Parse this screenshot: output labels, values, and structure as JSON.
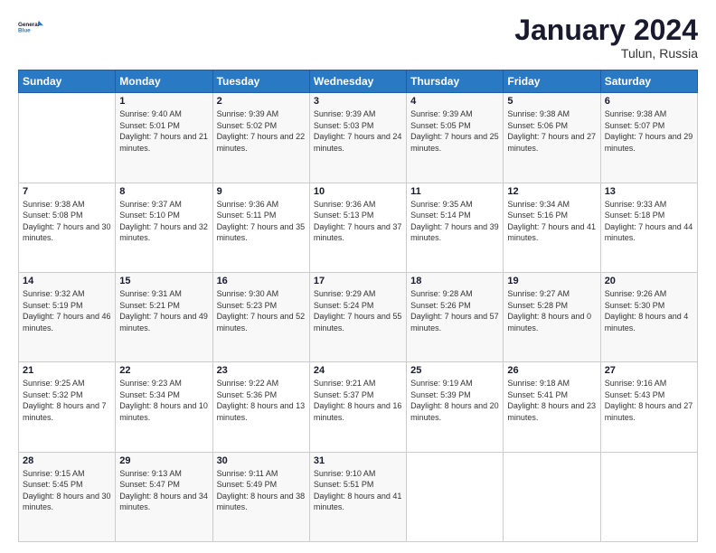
{
  "header": {
    "logo_line1": "General",
    "logo_line2": "Blue",
    "month_title": "January 2024",
    "location": "Tulun, Russia"
  },
  "weekdays": [
    "Sunday",
    "Monday",
    "Tuesday",
    "Wednesday",
    "Thursday",
    "Friday",
    "Saturday"
  ],
  "weeks": [
    [
      {
        "day": "",
        "sunrise": "",
        "sunset": "",
        "daylight": ""
      },
      {
        "day": "1",
        "sunrise": "Sunrise: 9:40 AM",
        "sunset": "Sunset: 5:01 PM",
        "daylight": "Daylight: 7 hours and 21 minutes."
      },
      {
        "day": "2",
        "sunrise": "Sunrise: 9:39 AM",
        "sunset": "Sunset: 5:02 PM",
        "daylight": "Daylight: 7 hours and 22 minutes."
      },
      {
        "day": "3",
        "sunrise": "Sunrise: 9:39 AM",
        "sunset": "Sunset: 5:03 PM",
        "daylight": "Daylight: 7 hours and 24 minutes."
      },
      {
        "day": "4",
        "sunrise": "Sunrise: 9:39 AM",
        "sunset": "Sunset: 5:05 PM",
        "daylight": "Daylight: 7 hours and 25 minutes."
      },
      {
        "day": "5",
        "sunrise": "Sunrise: 9:38 AM",
        "sunset": "Sunset: 5:06 PM",
        "daylight": "Daylight: 7 hours and 27 minutes."
      },
      {
        "day": "6",
        "sunrise": "Sunrise: 9:38 AM",
        "sunset": "Sunset: 5:07 PM",
        "daylight": "Daylight: 7 hours and 29 minutes."
      }
    ],
    [
      {
        "day": "7",
        "sunrise": "Sunrise: 9:38 AM",
        "sunset": "Sunset: 5:08 PM",
        "daylight": "Daylight: 7 hours and 30 minutes."
      },
      {
        "day": "8",
        "sunrise": "Sunrise: 9:37 AM",
        "sunset": "Sunset: 5:10 PM",
        "daylight": "Daylight: 7 hours and 32 minutes."
      },
      {
        "day": "9",
        "sunrise": "Sunrise: 9:36 AM",
        "sunset": "Sunset: 5:11 PM",
        "daylight": "Daylight: 7 hours and 35 minutes."
      },
      {
        "day": "10",
        "sunrise": "Sunrise: 9:36 AM",
        "sunset": "Sunset: 5:13 PM",
        "daylight": "Daylight: 7 hours and 37 minutes."
      },
      {
        "day": "11",
        "sunrise": "Sunrise: 9:35 AM",
        "sunset": "Sunset: 5:14 PM",
        "daylight": "Daylight: 7 hours and 39 minutes."
      },
      {
        "day": "12",
        "sunrise": "Sunrise: 9:34 AM",
        "sunset": "Sunset: 5:16 PM",
        "daylight": "Daylight: 7 hours and 41 minutes."
      },
      {
        "day": "13",
        "sunrise": "Sunrise: 9:33 AM",
        "sunset": "Sunset: 5:18 PM",
        "daylight": "Daylight: 7 hours and 44 minutes."
      }
    ],
    [
      {
        "day": "14",
        "sunrise": "Sunrise: 9:32 AM",
        "sunset": "Sunset: 5:19 PM",
        "daylight": "Daylight: 7 hours and 46 minutes."
      },
      {
        "day": "15",
        "sunrise": "Sunrise: 9:31 AM",
        "sunset": "Sunset: 5:21 PM",
        "daylight": "Daylight: 7 hours and 49 minutes."
      },
      {
        "day": "16",
        "sunrise": "Sunrise: 9:30 AM",
        "sunset": "Sunset: 5:23 PM",
        "daylight": "Daylight: 7 hours and 52 minutes."
      },
      {
        "day": "17",
        "sunrise": "Sunrise: 9:29 AM",
        "sunset": "Sunset: 5:24 PM",
        "daylight": "Daylight: 7 hours and 55 minutes."
      },
      {
        "day": "18",
        "sunrise": "Sunrise: 9:28 AM",
        "sunset": "Sunset: 5:26 PM",
        "daylight": "Daylight: 7 hours and 57 minutes."
      },
      {
        "day": "19",
        "sunrise": "Sunrise: 9:27 AM",
        "sunset": "Sunset: 5:28 PM",
        "daylight": "Daylight: 8 hours and 0 minutes."
      },
      {
        "day": "20",
        "sunrise": "Sunrise: 9:26 AM",
        "sunset": "Sunset: 5:30 PM",
        "daylight": "Daylight: 8 hours and 4 minutes."
      }
    ],
    [
      {
        "day": "21",
        "sunrise": "Sunrise: 9:25 AM",
        "sunset": "Sunset: 5:32 PM",
        "daylight": "Daylight: 8 hours and 7 minutes."
      },
      {
        "day": "22",
        "sunrise": "Sunrise: 9:23 AM",
        "sunset": "Sunset: 5:34 PM",
        "daylight": "Daylight: 8 hours and 10 minutes."
      },
      {
        "day": "23",
        "sunrise": "Sunrise: 9:22 AM",
        "sunset": "Sunset: 5:36 PM",
        "daylight": "Daylight: 8 hours and 13 minutes."
      },
      {
        "day": "24",
        "sunrise": "Sunrise: 9:21 AM",
        "sunset": "Sunset: 5:37 PM",
        "daylight": "Daylight: 8 hours and 16 minutes."
      },
      {
        "day": "25",
        "sunrise": "Sunrise: 9:19 AM",
        "sunset": "Sunset: 5:39 PM",
        "daylight": "Daylight: 8 hours and 20 minutes."
      },
      {
        "day": "26",
        "sunrise": "Sunrise: 9:18 AM",
        "sunset": "Sunset: 5:41 PM",
        "daylight": "Daylight: 8 hours and 23 minutes."
      },
      {
        "day": "27",
        "sunrise": "Sunrise: 9:16 AM",
        "sunset": "Sunset: 5:43 PM",
        "daylight": "Daylight: 8 hours and 27 minutes."
      }
    ],
    [
      {
        "day": "28",
        "sunrise": "Sunrise: 9:15 AM",
        "sunset": "Sunset: 5:45 PM",
        "daylight": "Daylight: 8 hours and 30 minutes."
      },
      {
        "day": "29",
        "sunrise": "Sunrise: 9:13 AM",
        "sunset": "Sunset: 5:47 PM",
        "daylight": "Daylight: 8 hours and 34 minutes."
      },
      {
        "day": "30",
        "sunrise": "Sunrise: 9:11 AM",
        "sunset": "Sunset: 5:49 PM",
        "daylight": "Daylight: 8 hours and 38 minutes."
      },
      {
        "day": "31",
        "sunrise": "Sunrise: 9:10 AM",
        "sunset": "Sunset: 5:51 PM",
        "daylight": "Daylight: 8 hours and 41 minutes."
      },
      {
        "day": "",
        "sunrise": "",
        "sunset": "",
        "daylight": ""
      },
      {
        "day": "",
        "sunrise": "",
        "sunset": "",
        "daylight": ""
      },
      {
        "day": "",
        "sunrise": "",
        "sunset": "",
        "daylight": ""
      }
    ]
  ]
}
